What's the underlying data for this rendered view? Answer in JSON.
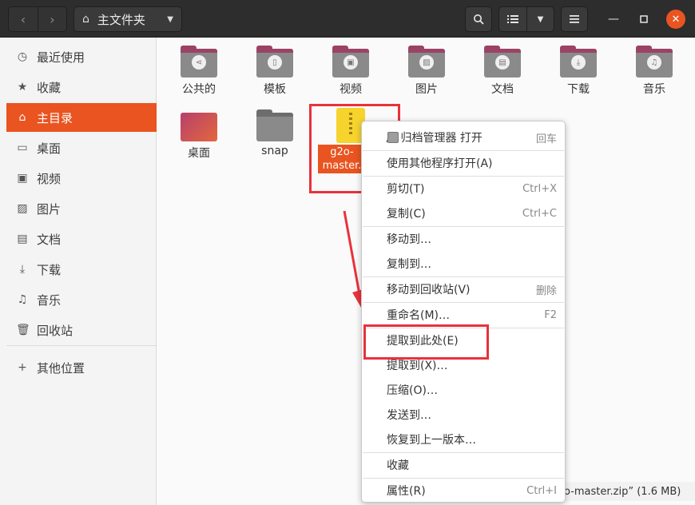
{
  "header": {
    "back_icon": "chevron-left-icon",
    "forward_icon": "chevron-right-icon",
    "location_label": "主文件夹",
    "search_icon": "search-icon",
    "view_icon": "list-view-icon",
    "menu_icon": "hamburger-menu-icon",
    "minimize_icon": "minimize-icon",
    "maximize_icon": "maximize-icon",
    "close_icon": "close-icon"
  },
  "sidebar": {
    "items": [
      {
        "label": "最近使用",
        "icon": "clock-icon"
      },
      {
        "label": "收藏",
        "icon": "star-icon"
      },
      {
        "label": "主目录",
        "icon": "home-icon"
      },
      {
        "label": "桌面",
        "icon": "desktop-icon"
      },
      {
        "label": "视频",
        "icon": "film-icon"
      },
      {
        "label": "图片",
        "icon": "image-icon"
      },
      {
        "label": "文档",
        "icon": "document-icon"
      },
      {
        "label": "下载",
        "icon": "download-icon"
      },
      {
        "label": "音乐",
        "icon": "music-icon"
      },
      {
        "label": "回收站",
        "icon": "trash-icon"
      }
    ],
    "other_locations": {
      "label": "其他位置",
      "icon": "plus-icon"
    }
  },
  "files": {
    "row1": [
      "公共的",
      "模板",
      "视频",
      "图片",
      "文档",
      "下载",
      "音乐"
    ],
    "row2": [
      "桌面",
      "snap"
    ],
    "selected_zip_label": "g2o-\nmaster."
  },
  "status": {
    "text": "o-master.zip” (1.6 MB)"
  },
  "context_menu": {
    "items": [
      {
        "label": "用 归档管理器 打开",
        "accel": "回车"
      },
      {
        "label": "使用其他程序打开(A)",
        "accel": ""
      },
      {
        "label": "剪切(T)",
        "accel": "Ctrl+X"
      },
      {
        "label": "复制(C)",
        "accel": "Ctrl+C"
      },
      {
        "label": "移动到…",
        "accel": ""
      },
      {
        "label": "复制到…",
        "accel": ""
      },
      {
        "label": "移动到回收站(V)",
        "accel": "删除"
      },
      {
        "label": "重命名(M)…",
        "accel": "F2"
      },
      {
        "label": "提取到此处(E)",
        "accel": ""
      },
      {
        "label": "提取到(X)…",
        "accel": ""
      },
      {
        "label": "压缩(O)…",
        "accel": ""
      },
      {
        "label": "发送到…",
        "accel": ""
      },
      {
        "label": "恢复到上一版本…",
        "accel": ""
      },
      {
        "label": "收藏",
        "accel": ""
      },
      {
        "label": "属性(R)",
        "accel": "Ctrl+I"
      }
    ]
  },
  "colors": {
    "accent": "#e95420",
    "highlight_box": "#e8323b"
  }
}
